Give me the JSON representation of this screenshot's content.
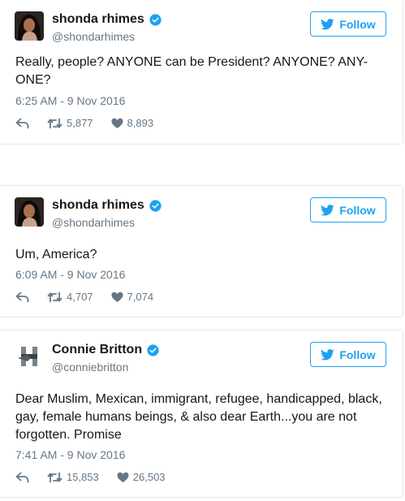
{
  "tweets": [
    {
      "display_name": "shonda rhimes",
      "handle": "@shondarhimes",
      "follow_label": "Follow",
      "text": "Really, people? ANYONE can be President? ANYONE? ANY-ONE?",
      "timestamp": "6:25 AM - 9 Nov 2016",
      "retweets": "5,877",
      "likes": "8,893",
      "verified": true,
      "avatar": "portrait-photo"
    },
    {
      "display_name": "shonda rhimes",
      "handle": "@shondarhimes",
      "follow_label": "Follow",
      "text": "Um, America?",
      "timestamp": "6:09 AM - 9 Nov 2016",
      "retweets": "4,707",
      "likes": "7,074",
      "verified": true,
      "avatar": "portrait-photo"
    },
    {
      "display_name": "Connie Britton",
      "handle": "@conniebritton",
      "follow_label": "Follow",
      "text": "Dear Muslim, Mexican, immigrant, refugee, handicapped, black, gay, female humans beings, & also dear Earth...you are not forgotten. Promise",
      "timestamp": "7:41 AM - 9 Nov 2016",
      "retweets": "15,853",
      "likes": "26,503",
      "verified": true,
      "avatar": "campaign-logo"
    }
  ],
  "colors": {
    "accent": "#1da1f2",
    "muted": "#657786",
    "border": "#e1e8ed",
    "text": "#14171a"
  },
  "icons": [
    "reply-icon",
    "retweet-icon",
    "heart-icon",
    "twitter-bird-icon",
    "verified-badge-icon"
  ]
}
